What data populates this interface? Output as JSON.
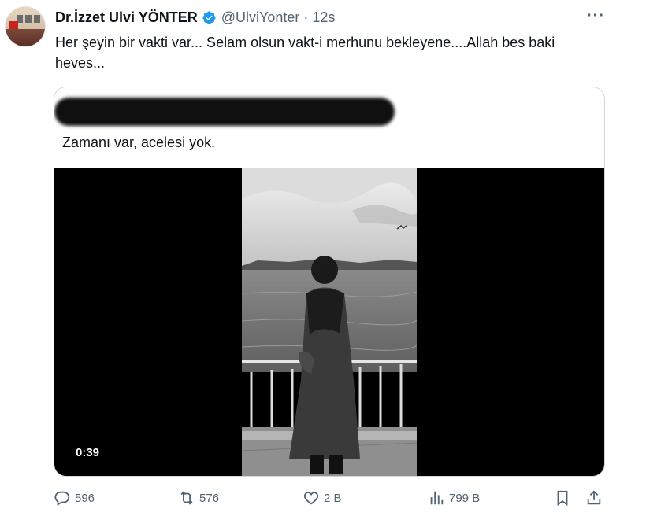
{
  "author": {
    "display_name": "Dr.İzzet Ulvi YÖNTER",
    "handle": "@UlviYonter",
    "separator": "·",
    "time": "12s",
    "verified_color": "#1d9bf0"
  },
  "tweet": {
    "text": "Her şeyin bir vakti var... Selam olsun vakt-i merhunu bekleyene....Allah bes baki heves..."
  },
  "quoted": {
    "text": "Zamanı var, acelesi yok.",
    "video_duration": "0:39"
  },
  "actions": {
    "replies": "596",
    "reposts": "576",
    "likes": "2 B",
    "views": "799 B"
  },
  "icons": [
    "more-icon",
    "reply-icon",
    "repost-icon",
    "like-icon",
    "views-icon",
    "bookmark-icon",
    "share-icon",
    "verified-badge-icon"
  ]
}
